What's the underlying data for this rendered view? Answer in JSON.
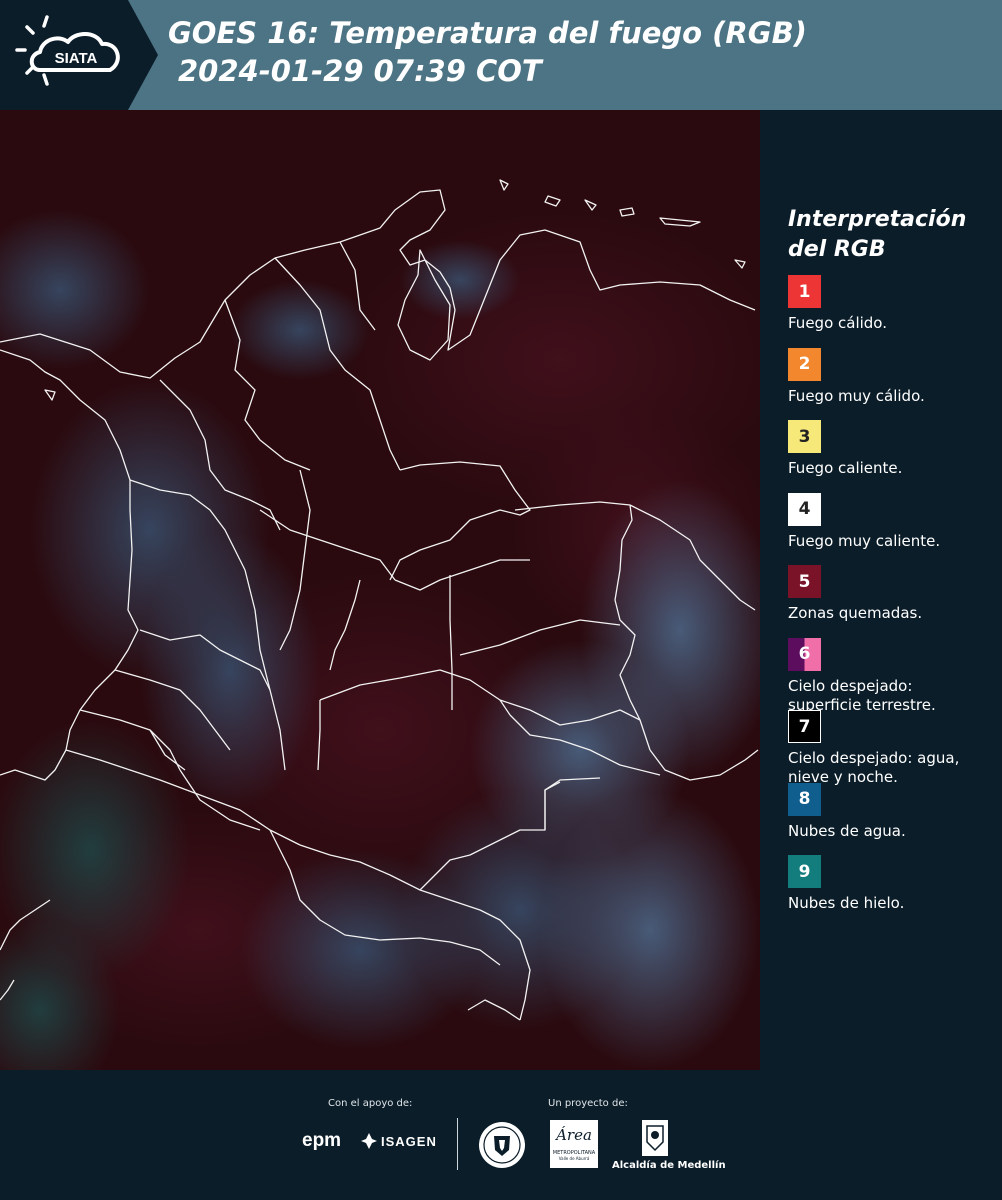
{
  "header": {
    "logo_text": "SIATA",
    "title_line1": "GOES 16: Temperatura del fuego (RGB)",
    "title_line2": "2024-01-29 07:39 COT"
  },
  "legend": {
    "title_line1": "Interpretación",
    "title_line2": "del RGB",
    "items": [
      {
        "num": "1",
        "color": "#ee3535",
        "label": "Fuego cálido."
      },
      {
        "num": "2",
        "color": "#f2872d",
        "label": "Fuego muy cálido."
      },
      {
        "num": "3",
        "color": "#f7e87a",
        "label": "Fuego caliente."
      },
      {
        "num": "4",
        "color": "#ffffff",
        "label": "Fuego muy caliente."
      },
      {
        "num": "5",
        "color": "#7a1228",
        "label": "Zonas quemadas."
      },
      {
        "num": "6",
        "color": "#5c0d5e",
        "color2": "#f06fa8",
        "label": "Cielo despejado: superficie terrestre."
      },
      {
        "num": "7",
        "color": "#000000",
        "label": "Cielo despejado: agua, nieve y noche."
      },
      {
        "num": "8",
        "color": "#0f5e8e",
        "label": "Nubes de agua."
      },
      {
        "num": "9",
        "color": "#137c7d",
        "label": "Nubes de hielo."
      }
    ]
  },
  "footer": {
    "support_label": "Con el apoyo de:",
    "project_label": "Un proyecto de:",
    "logos": {
      "epm": "epm",
      "isagen": "ISAGEN",
      "metropolitana_line1": "Área",
      "metropolitana_line2": "METROPOLITANA",
      "metropolitana_line3": "Valle de Aburrá",
      "alcaldia": "Alcaldía de Medellín"
    }
  }
}
